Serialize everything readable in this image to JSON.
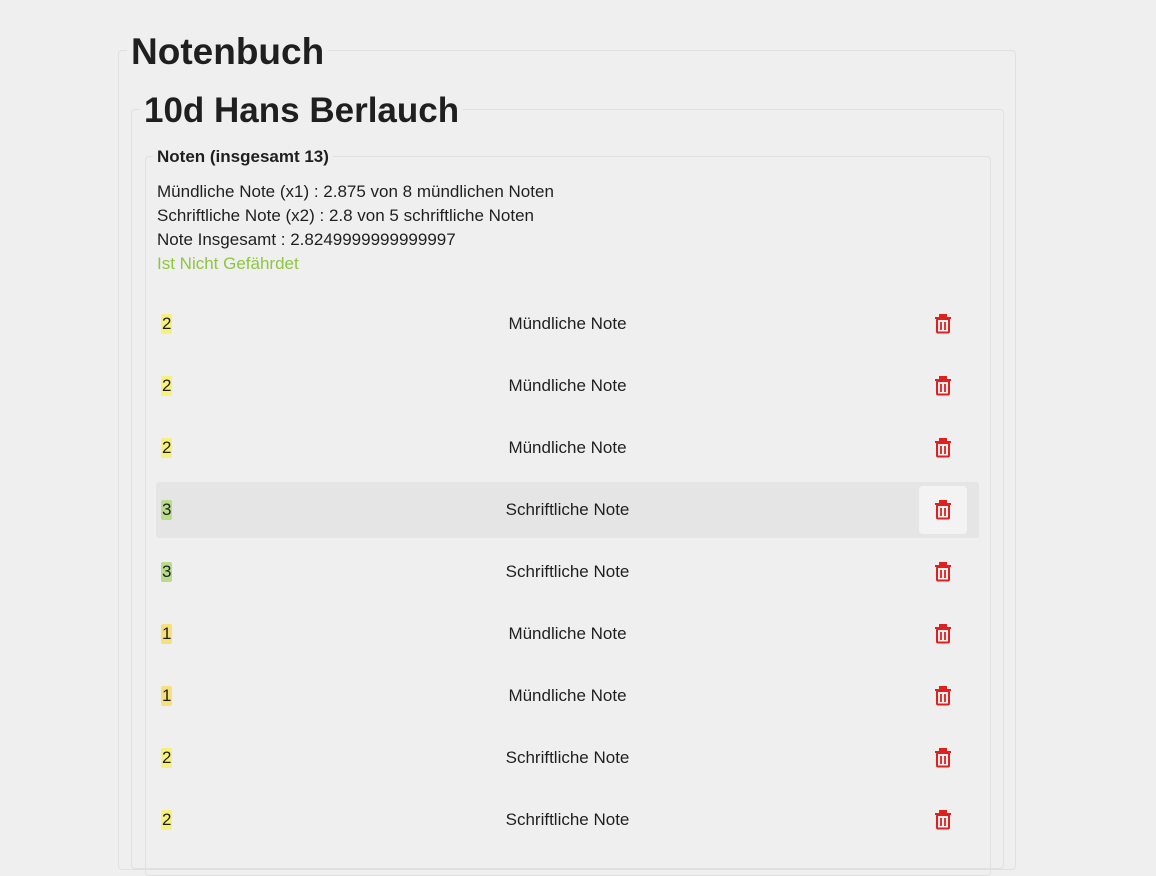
{
  "page": {
    "title": "Notenbuch",
    "student_title": "10d Hans Berlauch"
  },
  "grades_section": {
    "legend": "Noten (insgesamt 13)",
    "summary": {
      "oral_line": "Mündliche Note (x1) : 2.875 von 8 mündlichen Noten",
      "written_line": "Schriftliche Note (x2) : 2.8 von 5 schriftliche Noten",
      "total_line": "Note Insgesamt : 2.8249999999999997",
      "status": "Ist Nicht Gefährdet"
    },
    "items": [
      {
        "grade": "2",
        "type": "Mündliche Note",
        "highlight": "#f7f07a"
      },
      {
        "grade": "2",
        "type": "Mündliche Note",
        "highlight": "#f7f07a"
      },
      {
        "grade": "2",
        "type": "Mündliche Note",
        "highlight": "#f7f07a"
      },
      {
        "grade": "3",
        "type": "Schriftliche Note",
        "highlight": "#b7dc8c"
      },
      {
        "grade": "3",
        "type": "Schriftliche Note",
        "highlight": "#b7dc8c"
      },
      {
        "grade": "1",
        "type": "Mündliche Note",
        "highlight": "#f7e07a"
      },
      {
        "grade": "1",
        "type": "Mündliche Note",
        "highlight": "#f7e07a"
      },
      {
        "grade": "2",
        "type": "Schriftliche Note",
        "highlight": "#f7f07a"
      },
      {
        "grade": "2",
        "type": "Schriftliche Note",
        "highlight": "#f7f07a"
      }
    ],
    "delete_icon": "trash-icon",
    "colors": {
      "status_ok": "#8dc63f",
      "delete_icon": "#e0201f",
      "hover_row": "#e5e5e5"
    }
  }
}
